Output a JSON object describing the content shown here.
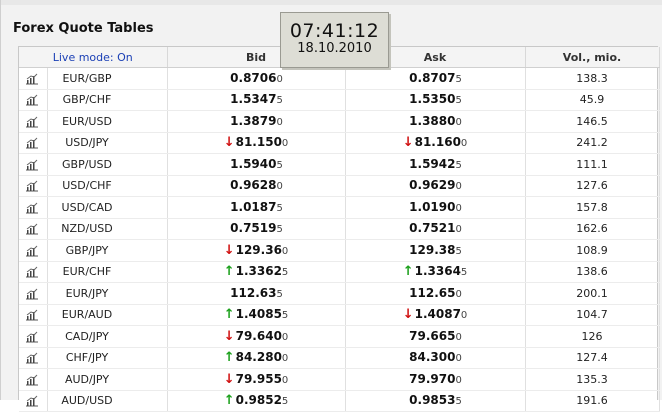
{
  "page": {
    "title": "Forex Quote Tables"
  },
  "clock": {
    "time": "07:41:12",
    "date": "18.10.2010"
  },
  "table": {
    "headers": {
      "live": "Live mode: On",
      "bid": "Bid",
      "ask": "Ask",
      "vol": "Vol., mio."
    },
    "rows": [
      {
        "pair": "EUR/GBP",
        "bid_main": "0.8706",
        "bid_pip": "0",
        "bid_dir": "",
        "ask_main": "0.8707",
        "ask_pip": "5",
        "ask_dir": "",
        "vol": "138.3"
      },
      {
        "pair": "GBP/CHF",
        "bid_main": "1.5347",
        "bid_pip": "5",
        "bid_dir": "",
        "ask_main": "1.5350",
        "ask_pip": "5",
        "ask_dir": "",
        "vol": "45.9"
      },
      {
        "pair": "EUR/USD",
        "bid_main": "1.3879",
        "bid_pip": "0",
        "bid_dir": "",
        "ask_main": "1.3880",
        "ask_pip": "0",
        "ask_dir": "",
        "vol": "146.5"
      },
      {
        "pair": "USD/JPY",
        "bid_main": "81.150",
        "bid_pip": "0",
        "bid_dir": "down",
        "ask_main": "81.160",
        "ask_pip": "0",
        "ask_dir": "down",
        "vol": "241.2"
      },
      {
        "pair": "GBP/USD",
        "bid_main": "1.5940",
        "bid_pip": "5",
        "bid_dir": "",
        "ask_main": "1.5942",
        "ask_pip": "5",
        "ask_dir": "",
        "vol": "111.1"
      },
      {
        "pair": "USD/CHF",
        "bid_main": "0.9628",
        "bid_pip": "0",
        "bid_dir": "",
        "ask_main": "0.9629",
        "ask_pip": "0",
        "ask_dir": "",
        "vol": "127.6"
      },
      {
        "pair": "USD/CAD",
        "bid_main": "1.0187",
        "bid_pip": "5",
        "bid_dir": "",
        "ask_main": "1.0190",
        "ask_pip": "0",
        "ask_dir": "",
        "vol": "157.8"
      },
      {
        "pair": "NZD/USD",
        "bid_main": "0.7519",
        "bid_pip": "5",
        "bid_dir": "",
        "ask_main": "0.7521",
        "ask_pip": "0",
        "ask_dir": "",
        "vol": "162.6"
      },
      {
        "pair": "GBP/JPY",
        "bid_main": "129.36",
        "bid_pip": "0",
        "bid_dir": "down",
        "ask_main": "129.38",
        "ask_pip": "5",
        "ask_dir": "",
        "vol": "108.9"
      },
      {
        "pair": "EUR/CHF",
        "bid_main": "1.3362",
        "bid_pip": "5",
        "bid_dir": "up",
        "ask_main": "1.3364",
        "ask_pip": "5",
        "ask_dir": "up",
        "vol": "138.6"
      },
      {
        "pair": "EUR/JPY",
        "bid_main": "112.63",
        "bid_pip": "5",
        "bid_dir": "",
        "ask_main": "112.65",
        "ask_pip": "0",
        "ask_dir": "",
        "vol": "200.1"
      },
      {
        "pair": "EUR/AUD",
        "bid_main": "1.4085",
        "bid_pip": "5",
        "bid_dir": "up",
        "ask_main": "1.4087",
        "ask_pip": "0",
        "ask_dir": "down",
        "vol": "104.7"
      },
      {
        "pair": "CAD/JPY",
        "bid_main": "79.640",
        "bid_pip": "0",
        "bid_dir": "down",
        "ask_main": "79.665",
        "ask_pip": "0",
        "ask_dir": "",
        "vol": "126"
      },
      {
        "pair": "CHF/JPY",
        "bid_main": "84.280",
        "bid_pip": "0",
        "bid_dir": "up",
        "ask_main": "84.300",
        "ask_pip": "0",
        "ask_dir": "",
        "vol": "127.4"
      },
      {
        "pair": "AUD/JPY",
        "bid_main": "79.955",
        "bid_pip": "0",
        "bid_dir": "down",
        "ask_main": "79.970",
        "ask_pip": "0",
        "ask_dir": "",
        "vol": "135.3"
      },
      {
        "pair": "AUD/USD",
        "bid_main": "0.9852",
        "bid_pip": "5",
        "bid_dir": "up",
        "ask_main": "0.9853",
        "ask_pip": "5",
        "ask_dir": "",
        "vol": "191.6"
      }
    ]
  },
  "icons": {
    "row_chart": "chart-icon",
    "down_arrow": "down-arrow-icon",
    "up_arrow": "up-arrow-icon"
  },
  "colors": {
    "down": "#d01010",
    "up": "#1ca01c",
    "live_link": "#1a3fb5"
  }
}
